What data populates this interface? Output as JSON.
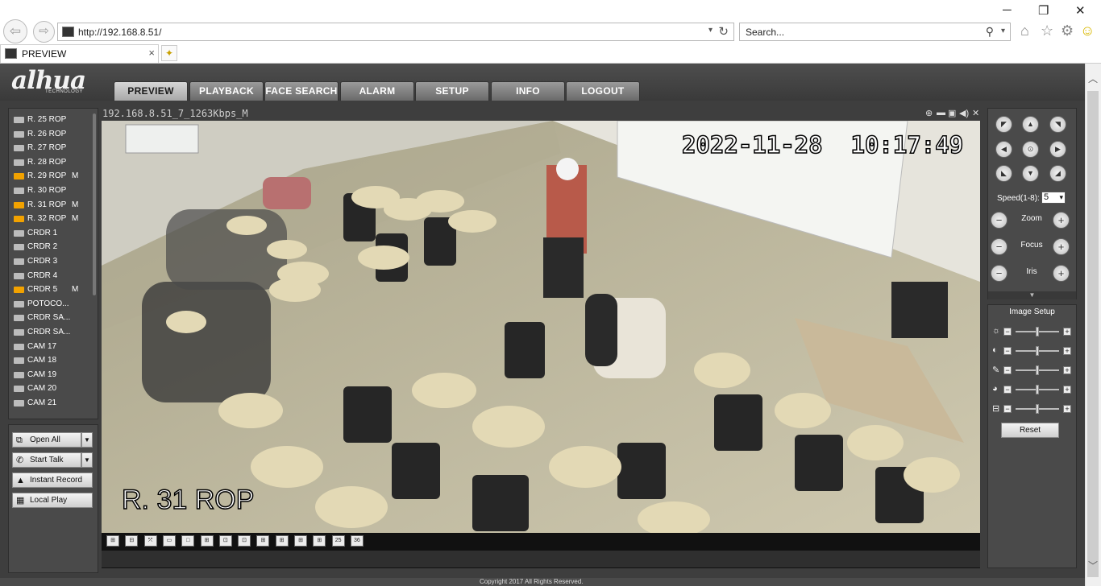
{
  "browser": {
    "url": "http://192.168.8.51/",
    "search_placeholder": "Search...",
    "tab_title": "PREVIEW",
    "tab_close": "×",
    "back": "⇦",
    "forward": "⇨",
    "min": "─",
    "max": "❐",
    "close": "✕"
  },
  "app": {
    "logo": "alhua",
    "logo_sub": "TECHNOLOGY",
    "nav": [
      "PREVIEW",
      "PLAYBACK",
      "FACE SEARCH",
      "ALARM",
      "SETUP",
      "INFO",
      "LOGOUT"
    ],
    "active_tab": "PREVIEW"
  },
  "devices": [
    {
      "label": "R. 25 ROP",
      "flag": "",
      "recording": false
    },
    {
      "label": "R. 26 ROP",
      "flag": "",
      "recording": false
    },
    {
      "label": "R. 27 ROP",
      "flag": "",
      "recording": false
    },
    {
      "label": "R. 28 ROP",
      "flag": "",
      "recording": false
    },
    {
      "label": "R. 29 ROP",
      "flag": "M",
      "recording": true
    },
    {
      "label": "R. 30 ROP",
      "flag": "",
      "recording": false
    },
    {
      "label": "R. 31 ROP",
      "flag": "M",
      "recording": true
    },
    {
      "label": "R. 32 ROP",
      "flag": "M",
      "recording": true
    },
    {
      "label": "CRDR 1",
      "flag": "",
      "recording": false
    },
    {
      "label": "CRDR 2",
      "flag": "",
      "recording": false
    },
    {
      "label": "CRDR 3",
      "flag": "",
      "recording": false
    },
    {
      "label": "CRDR 4",
      "flag": "",
      "recording": false
    },
    {
      "label": "CRDR 5",
      "flag": "M",
      "recording": true
    },
    {
      "label": "POTOCO...",
      "flag": "",
      "recording": false
    },
    {
      "label": "CRDR SA...",
      "flag": "",
      "recording": false
    },
    {
      "label": "CRDR SA...",
      "flag": "",
      "recording": false
    },
    {
      "label": "CAM 17",
      "flag": "",
      "recording": false
    },
    {
      "label": "CAM 18",
      "flag": "",
      "recording": false
    },
    {
      "label": "CAM 19",
      "flag": "",
      "recording": false
    },
    {
      "label": "CAM 20",
      "flag": "",
      "recording": false
    },
    {
      "label": "CAM 21",
      "flag": "",
      "recording": false
    }
  ],
  "actions": {
    "open_all": "Open All",
    "start_talk": "Start Talk",
    "instant_record": "Instant Record",
    "local_play": "Local Play"
  },
  "video": {
    "info": "192.168.8.51_7_1263Kbps_M",
    "timestamp": "2022-11-28  10:17:49",
    "channel_name": "R. 31 ROP"
  },
  "split_buttons": [
    "⊞",
    "⊟",
    "⤧",
    "▭",
    "□",
    "⊞",
    "⊡",
    "⊡",
    "⊞",
    "⊞",
    "⊞",
    "⊞",
    "25",
    "36"
  ],
  "ptz": {
    "speed_label": "Speed(1-8):",
    "speed_value": "5",
    "zoom": "Zoom",
    "focus": "Focus",
    "iris": "Iris"
  },
  "image_setup": {
    "title": "Image Setup",
    "reset": "Reset",
    "levels": [
      0.5,
      0.5,
      0.5,
      0.5,
      0.5
    ]
  },
  "footer": "Copyright 2017 All Rights Reserved.",
  "colors": {
    "record_icon": "#f2a200",
    "panel_bg": "#4a4a4a",
    "active_tab_bg": "#c4c4c4"
  }
}
